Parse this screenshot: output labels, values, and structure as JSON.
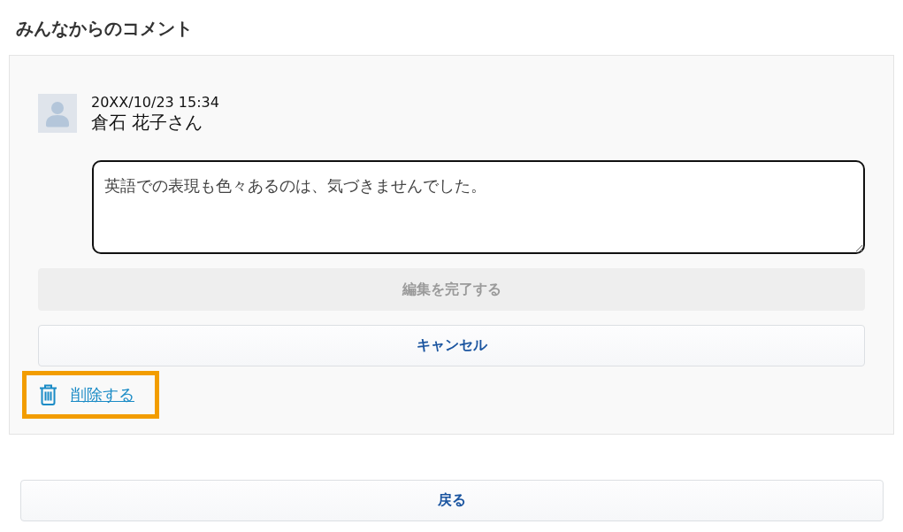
{
  "section_title": "みんなからのコメント",
  "comment": {
    "timestamp": "20XX/10/23 15:34",
    "author": "倉石 花子さん",
    "editor": {
      "value": "英語での表現も色々あるのは、気づきませんでした。"
    },
    "buttons": [
      {
        "label": "編集を完了する",
        "disabled": true
      },
      {
        "label": "キャンセル",
        "disabled": false
      }
    ],
    "delete_link": {
      "label": "削除する",
      "highlighted": true
    }
  },
  "back_button": {
    "label": "戻る"
  }
}
